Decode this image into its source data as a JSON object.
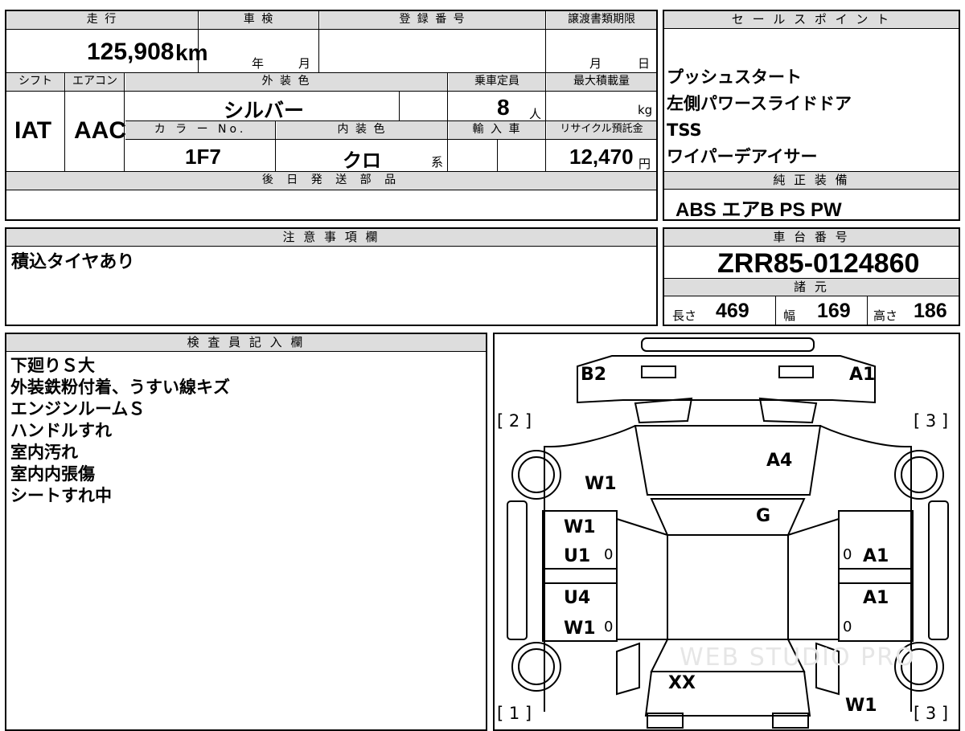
{
  "top": {
    "mileage_header": "走 行",
    "shaken_header": "車 検",
    "reg_header": "登 録 番 号",
    "transfer_header": "譲渡書類期限",
    "mileage": "125,908",
    "mileage_unit": "km",
    "shaken_year": "年",
    "shaken_month": "月",
    "transfer_month": "月",
    "transfer_day": "日",
    "shift_header": "シフト",
    "ac_header": "エアコン",
    "exterior_header": "外 装 色",
    "capacity_header": "乗車定員",
    "load_header": "最大積載量",
    "shift": "IAT",
    "ac": "AAC",
    "exterior_color": "シルバー",
    "capacity": "8",
    "capacity_unit": "人",
    "load_unit": "kg",
    "color_no_header": "カ ラ ー No.",
    "interior_header": "内 装 色",
    "import_header": "輸 入 車",
    "recycle_header": "リサイクル預託金",
    "color_no": "1F7",
    "interior_color": "クロ",
    "interior_suffix": "系",
    "recycle_fee": "12,470",
    "recycle_unit": "円",
    "later_parts_header": "後 日 発 送 部 品"
  },
  "sales": {
    "header": "セ ー ル ス ポ イ ン ト",
    "items": [
      "プッシュスタート",
      "左側パワースライドドア",
      "TSS",
      "ワイパーデアイサー"
    ]
  },
  "equipment": {
    "header": "純 正 装 備",
    "value": "ABS エアB PS PW"
  },
  "notes": {
    "header": "注 意 事 項 欄",
    "text": "積込タイヤあり"
  },
  "chassis": {
    "header": "車 台 番 号",
    "number": "ZRR85-0124860"
  },
  "specs": {
    "header": "諸 元",
    "length_label": "長さ",
    "length": "469",
    "width_label": "幅",
    "width": "169",
    "height_label": "高さ",
    "height": "186"
  },
  "inspector": {
    "header": "検 査 員 記 入 欄",
    "lines": [
      "下廻りＳ大",
      "外装鉄粉付着、うすい線キズ",
      "エンジンルームＳ",
      "ハンドルすれ",
      "室内汚れ",
      "室内内張傷",
      "シートすれ中"
    ]
  },
  "diagram": {
    "labels": {
      "b2": "B2",
      "a1_front": "A1",
      "a4": "A4",
      "g": "G",
      "w1_front": "W1",
      "w1_left_top": "W1",
      "u1": "U1",
      "u4": "U4",
      "w1_left_bottom": "W1",
      "a1_right_top": "A1",
      "a1_right_bottom": "A1",
      "xx": "XX",
      "w1_rear": "W1",
      "zero1": "0",
      "zero2": "0",
      "zero3": "0",
      "zero4": "0"
    },
    "corners": {
      "front_left": "[ 2 ]",
      "front_right": "[ 3 ]",
      "rear_left": "[ 1 ]",
      "rear_right": "[ 3 ]"
    },
    "watermark": "WEB STUDIO PRO"
  }
}
